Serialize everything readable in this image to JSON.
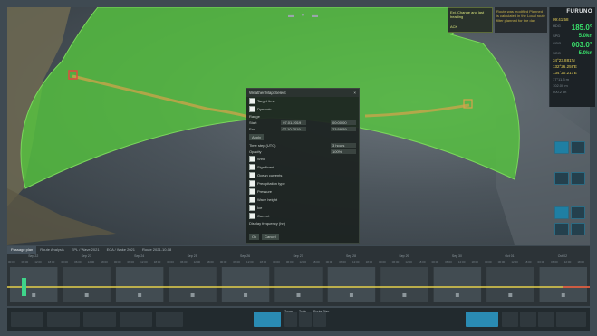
{
  "alert": {
    "title": "Ext. Change and last heading",
    "ack": "ACK",
    "detail": "Route was modified Planned is calculated in the Local route filter planned for the day"
  },
  "nav_panel": {
    "brand": "FURUNO",
    "time": "09:41:58",
    "hdg_label": "HDG",
    "hdg": "185.0°",
    "spd_label": "SPD",
    "spd": "5.0kn",
    "cog_label": "COG",
    "cog": "003.0°",
    "sog_label": "SOG",
    "sog": "5.0kn",
    "lat": "34°23.881'N",
    "lon": "132°26.259'E",
    "pos2": "134°20.217'E",
    "ts1": "17°11.3 m",
    "ts2": "102.00 m",
    "ts3": "000.2 kn"
  },
  "dialog": {
    "title": "Weather Map Select",
    "close": "×",
    "options_top": [
      "Target time",
      "Dynamic"
    ],
    "range_label": "Range",
    "start_label": "Start",
    "start_val": "07.01.2019",
    "start_val2": "00:00:00",
    "end_label": "End",
    "end_val": "07.10.2019",
    "end_val2": "23:59:59",
    "apply": "Apply",
    "time_step_label": "Time step (UTC)",
    "time_step_val": "3 hours",
    "opacity_label": "Opacity",
    "opacity_val": "100%",
    "layers": [
      "Wind",
      "Significant",
      "Ocean currents",
      "Precipitation type",
      "Pressure",
      "Wave height",
      "Ice",
      "Current"
    ],
    "footer": "Display frequency (hr.)",
    "ok": "Ok",
    "cancel": "Cancel"
  },
  "timeline": {
    "tabs": [
      "Passage plan",
      "Route Analysis",
      "EPL / Wave 2021",
      "ECA / Wake 2021",
      "Route 2021-10-08"
    ],
    "selected_tab": 0,
    "days": [
      "Sep 22",
      "Sep 23",
      "Sep 24",
      "Sep 25",
      "Sep 26",
      "Sep 27",
      "Sep 28",
      "Sep 29",
      "Sep 30",
      "Oct 01",
      "Oct 02"
    ],
    "times": [
      "00:00",
      "06:00",
      "12:00",
      "18:00"
    ]
  },
  "toolbar": {
    "zoom_label": "Zoom",
    "tools_label": "Tools",
    "route_label": "Route Plan"
  },
  "colors": {
    "overlay": "#56c83d",
    "track": "#d9a24a",
    "accent": "#2a8bb3",
    "timeline_line": "#e5d04a",
    "red_marker": "#e24b3f"
  }
}
